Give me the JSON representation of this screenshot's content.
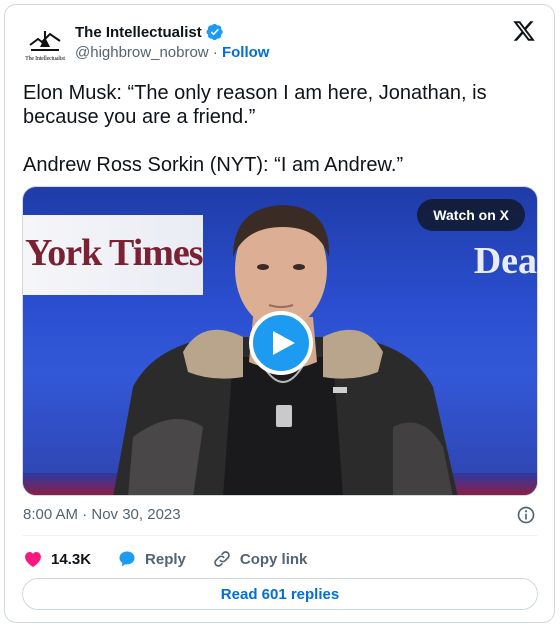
{
  "author": {
    "display_name": "The Intellectualist",
    "avatar_text": "The Intellectualist",
    "handle": "@highbrow_nobrow",
    "separator": " · ",
    "follow_label": "Follow",
    "verified": true,
    "verified_color": "#1d9bf0"
  },
  "tweet": {
    "text": "Elon Musk: “The only reason I am here, Jonathan, is because you are a friend.”\n\nAndrew Ross Sorkin (NYT): “I am Andrew.”"
  },
  "media": {
    "watch_label": "Watch on X",
    "banner_left_text": "York Times",
    "banner_right_text": "Dea",
    "play_icon": "play-icon"
  },
  "meta": {
    "timestamp": "8:00 AM · Nov 30, 2023"
  },
  "actions": {
    "likes_count": "14.3K",
    "reply_label": "Reply",
    "copy_link_label": "Copy link"
  },
  "replies_button": {
    "label": "Read 601 replies"
  },
  "colors": {
    "accent": "#1d9bf0",
    "link": "#006fd6",
    "like": "#f91880",
    "muted": "#536471",
    "border": "#cfd9de"
  }
}
